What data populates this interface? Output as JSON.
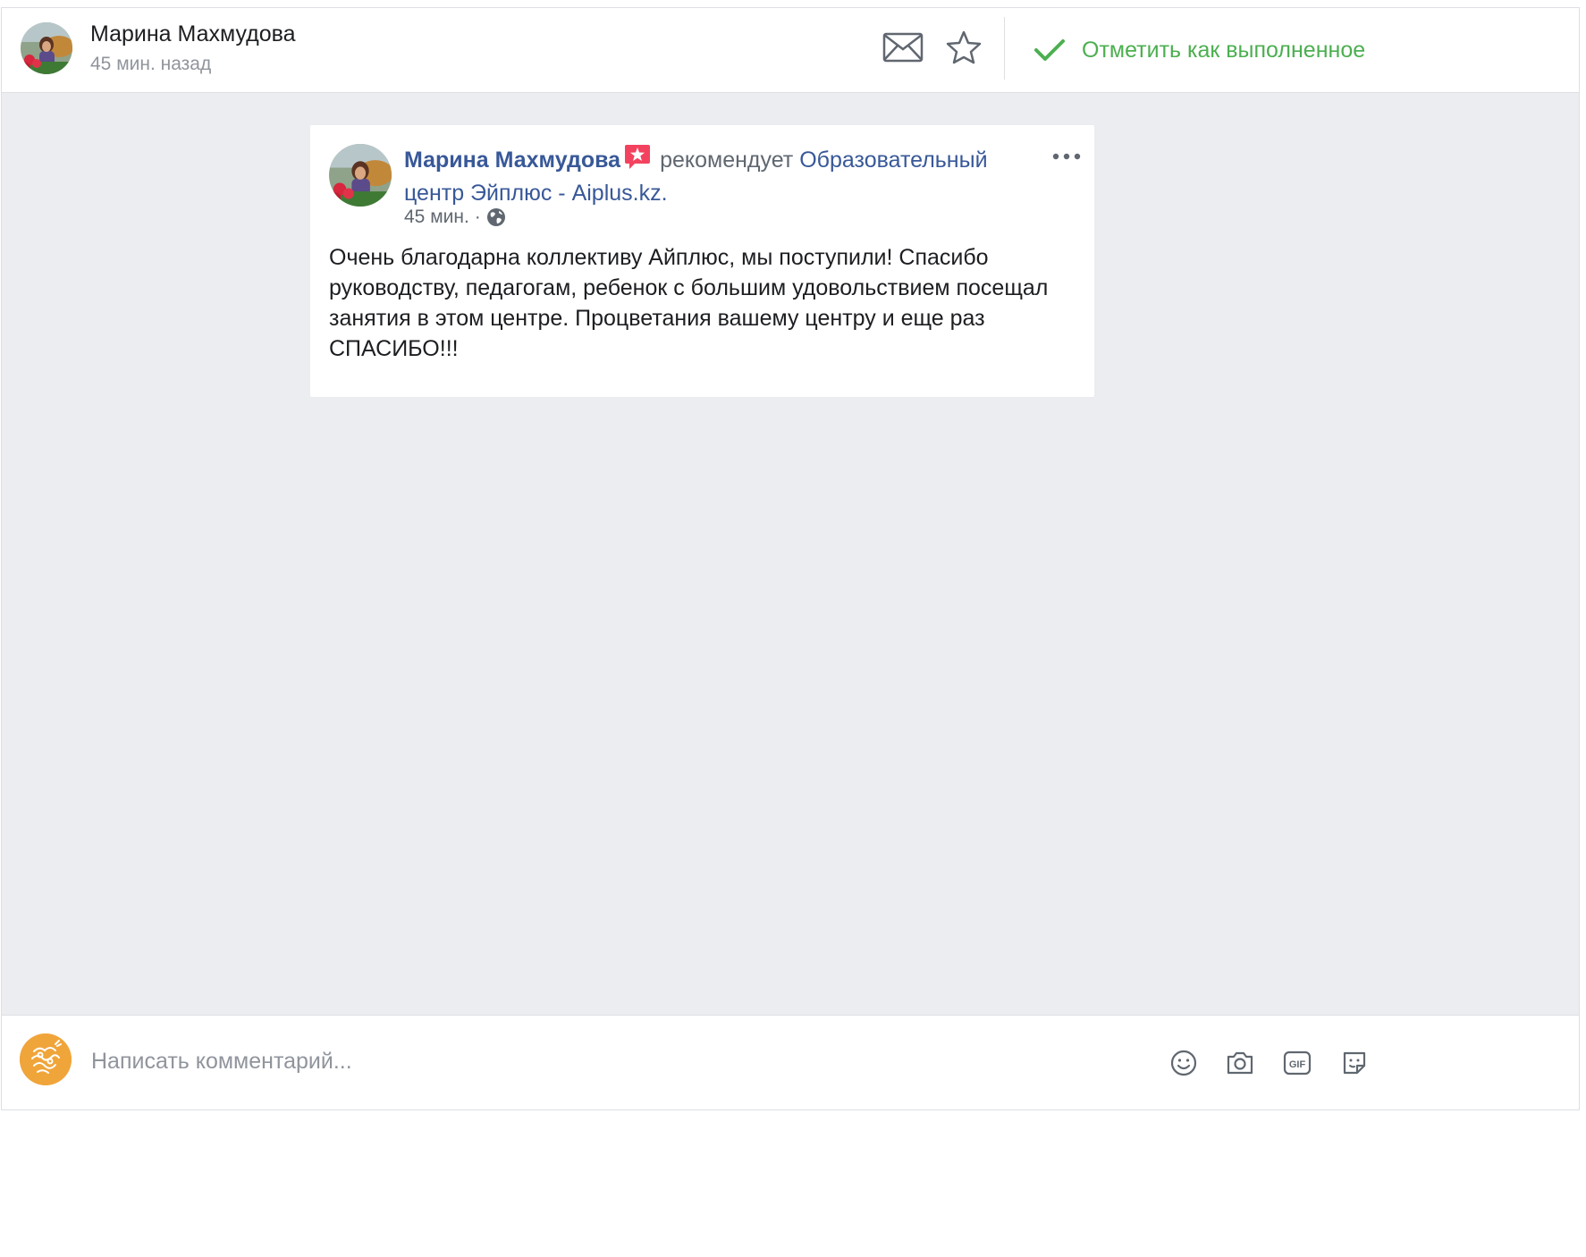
{
  "header": {
    "name": "Марина Махмудова",
    "time": "45 мин. назад",
    "mark_done_label": "Отметить как выполненное",
    "icons": [
      "mail-icon",
      "star-icon",
      "check-icon"
    ]
  },
  "post": {
    "author": "Марина Махмудова",
    "action": "рекомендует",
    "page_name": "Образовательный центр Эйплюс - Aiplus.kz.",
    "time": "45 мин.",
    "separator": "·",
    "privacy_icon": "globe-icon",
    "body": "Очень благодарна коллективу Айплюс, мы поступили! Спасибо руководству, педагогам, ребенок с большим удовольствием посещал занятия в этом центре. Процветания вашему центру и еще раз СПАСИБО!!!"
  },
  "composer": {
    "placeholder": "Написать комментарий...",
    "tools": [
      "emoji-icon",
      "camera-icon",
      "gif-icon",
      "sticker-icon"
    ]
  },
  "colors": {
    "link": "#385898",
    "done_green": "#4caf50",
    "badge_red": "#f3425f",
    "page_bg": "#ebedf0",
    "secondary_text": "#90949c"
  }
}
